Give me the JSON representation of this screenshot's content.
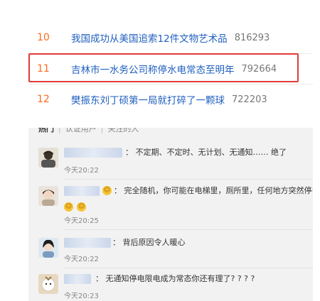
{
  "ranking": [
    {
      "rank": "10",
      "title": "我国成功从美国追索12件文物艺术品",
      "count": "816293"
    },
    {
      "rank": "11",
      "title": "吉林市一水务公司称停水电常态至明年",
      "count": "792664"
    },
    {
      "rank": "12",
      "title": "樊振东刘丁硕第一局就打碎了一颗球",
      "count": "722203"
    }
  ],
  "comments_header": {
    "tab_hot": "热门",
    "tab_verified": "认证用户",
    "tab_following": "关注的人"
  },
  "comments": [
    {
      "text": "：  不定期、不定时、无计划、无通知…… 绝了",
      "time": "今天20:22"
    },
    {
      "text": "：  完全随机，你可能在电梯里，厕所里，任何地方突然停电",
      "time": "今天20:25"
    },
    {
      "text": "：  背后原因令人暖心",
      "time": "今天20:22"
    },
    {
      "text": "：  无通知停电限电成为常态你还有理了? ? ? ?",
      "time": "今天20:23"
    }
  ],
  "colors": {
    "highlight_border": "#e23a3a",
    "rank_number": "#ff6a1a",
    "title_link": "#1f5fbf"
  }
}
